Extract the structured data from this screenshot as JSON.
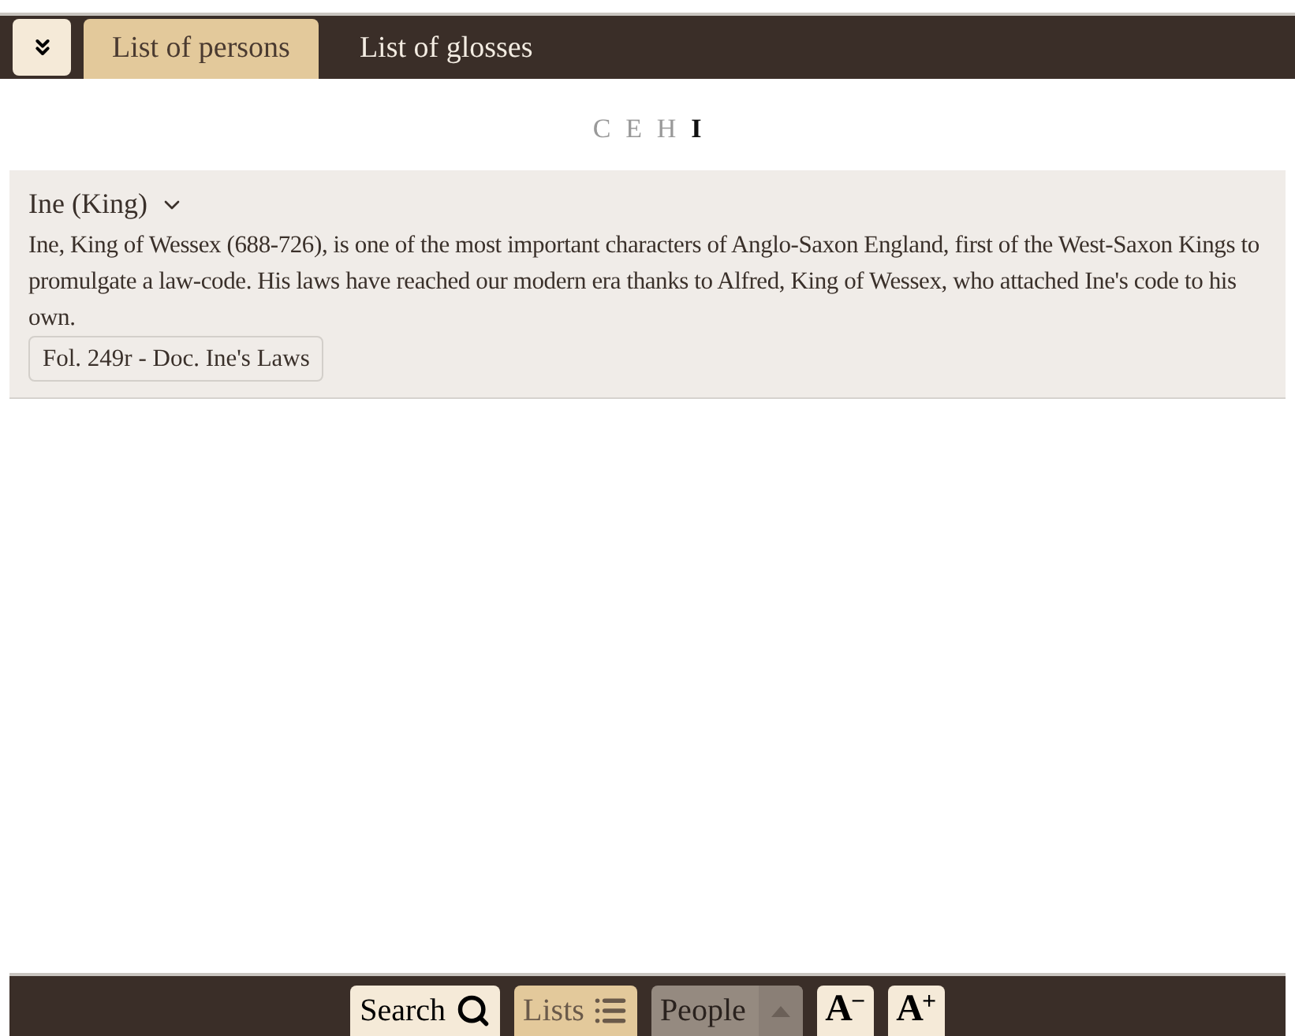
{
  "tabs": [
    {
      "label": "List of persons",
      "selected": true
    },
    {
      "label": "List of glosses",
      "selected": false
    }
  ],
  "letters": [
    {
      "label": "C",
      "selected": false
    },
    {
      "label": "E",
      "selected": false
    },
    {
      "label": "H",
      "selected": false
    },
    {
      "label": "I",
      "selected": true
    }
  ],
  "entries": [
    {
      "name": "Ine (King)",
      "expanded": true,
      "description": "Ine, King of Wessex (688-726), is one of the most important characters of Anglo-Saxon England, first of the West-Saxon Kings to promulgate a law-code. His laws have reached our modern era thanks to Alfred, King of Wessex, who attached Ine's code to his own.",
      "references": [
        "Fol. 249r - Doc. Ine's Laws"
      ]
    }
  ],
  "toolbar": [
    {
      "kind": "search",
      "label": "Search",
      "selected": false
    },
    {
      "kind": "lists",
      "label": "Lists",
      "selected": true
    },
    {
      "kind": "dropdown",
      "label": "People",
      "selected": false
    },
    {
      "kind": "font",
      "label": "A",
      "sign": "−"
    },
    {
      "kind": "font",
      "label": "A",
      "sign": "+"
    }
  ]
}
